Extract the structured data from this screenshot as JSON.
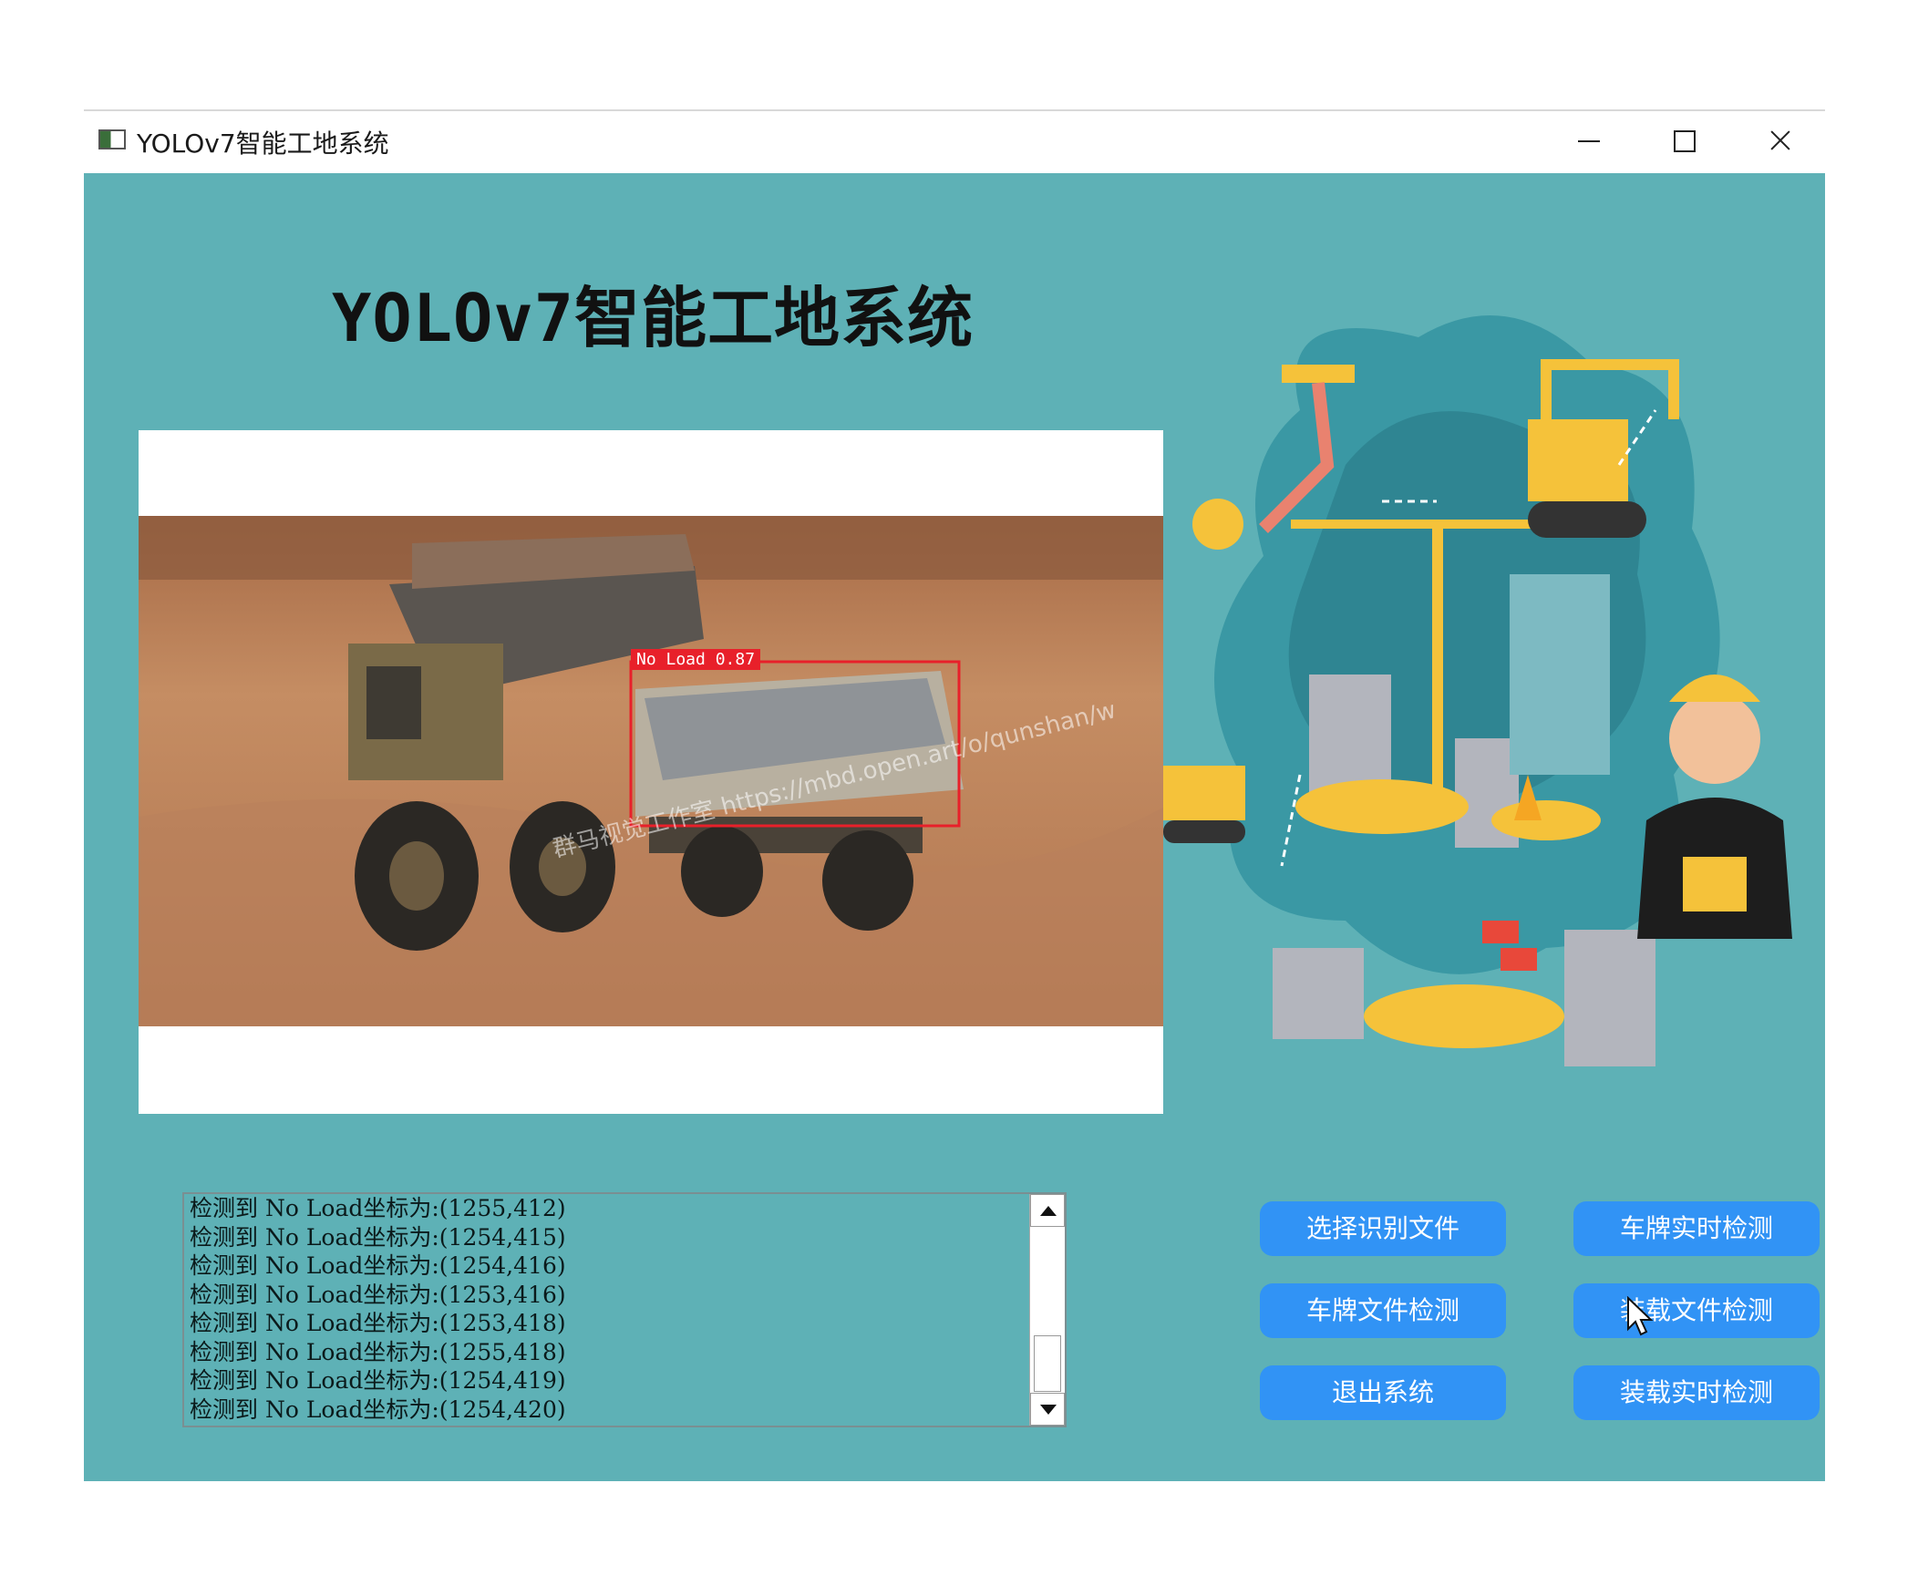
{
  "window": {
    "title": "YOLOv7智能工地系统",
    "controls": [
      "minimize-icon",
      "maximize-icon",
      "close-icon"
    ]
  },
  "app": {
    "heading": "YOLOv7智能工地系统"
  },
  "detection": {
    "label": "No Load 0.87",
    "watermark": "群马视觉工作室 https://mbd.open.art/o/qunshan/w",
    "box_color": "#e8202a"
  },
  "log": {
    "lines": [
      "检测到 No Load坐标为:(1255,412)",
      "检测到 No Load坐标为:(1254,415)",
      "检测到 No Load坐标为:(1254,416)",
      "检测到 No Load坐标为:(1253,416)",
      "检测到 No Load坐标为:(1253,418)",
      "检测到 No Load坐标为:(1255,418)",
      "检测到 No Load坐标为:(1254,419)",
      "检测到 No Load坐标为:(1254,420)"
    ]
  },
  "buttons": {
    "select_file": "选择识别文件",
    "plate_realtime": "车牌实时检测",
    "plate_file": "车牌文件检测",
    "load_file": "装载文件检测",
    "exit": "退出系统",
    "load_realtime": "装载实时检测"
  },
  "colors": {
    "background": "#5eb1b6",
    "button": "#3193f5",
    "button_text": "#ffffff"
  }
}
